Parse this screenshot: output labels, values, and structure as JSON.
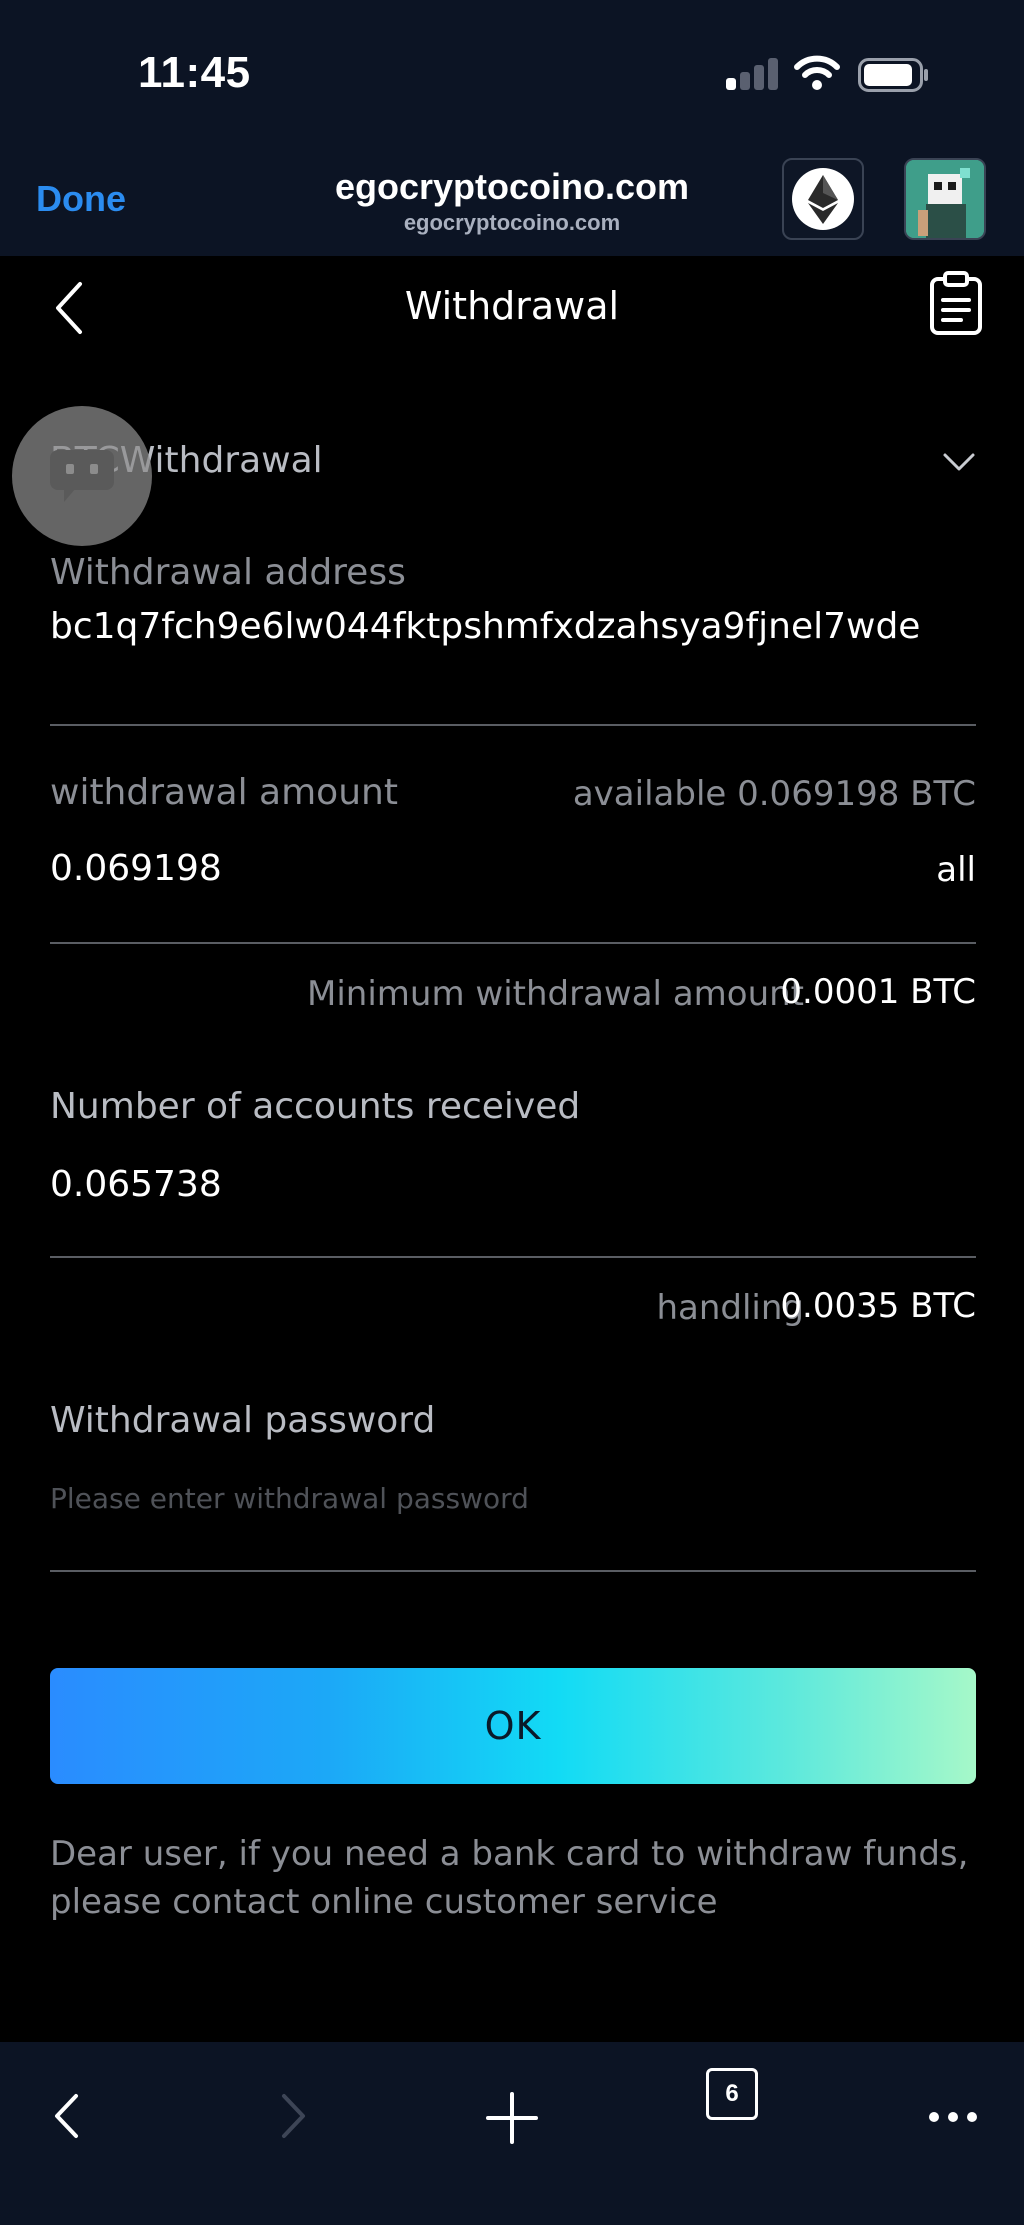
{
  "status_bar": {
    "time": "11:45"
  },
  "browser": {
    "done_label": "Done",
    "site_title": "egocryptocoino.com",
    "site_subtitle": "egocryptocoino.com",
    "tab_count": "6"
  },
  "header": {
    "title": "Withdrawal"
  },
  "coin_selector": {
    "label": "BTCWithdrawal"
  },
  "address": {
    "label": "Withdrawal address",
    "value": "bc1q7fch9e6lw044fktpshmfxdzahsya9fjnel7wde"
  },
  "amount": {
    "label": "withdrawal amount",
    "available": "available 0.069198 BTC",
    "value": "0.069198",
    "all_label": "all"
  },
  "minimum": {
    "label": "Minimum withdrawal amount",
    "value": "0.0001 BTC"
  },
  "received": {
    "label": "Number of accounts received",
    "value": "0.065738"
  },
  "handling": {
    "label": "handling",
    "value": "0.0035 BTC"
  },
  "password": {
    "label": "Withdrawal password",
    "placeholder": "Please enter withdrawal password"
  },
  "ok_button": {
    "label": "OK"
  },
  "notice": "Dear user, if you need a bank card to withdraw funds, please contact online customer service",
  "colors": {
    "accent_blue": "#2b8cf0",
    "background": "#000000",
    "bar": "#0c1424"
  },
  "icons": [
    "ethereum-icon",
    "avatar",
    "back-icon",
    "record-icon",
    "chevron-down-icon",
    "chat-icon",
    "browser-back-icon",
    "browser-forward-icon",
    "new-tab-icon",
    "more-icon"
  ]
}
